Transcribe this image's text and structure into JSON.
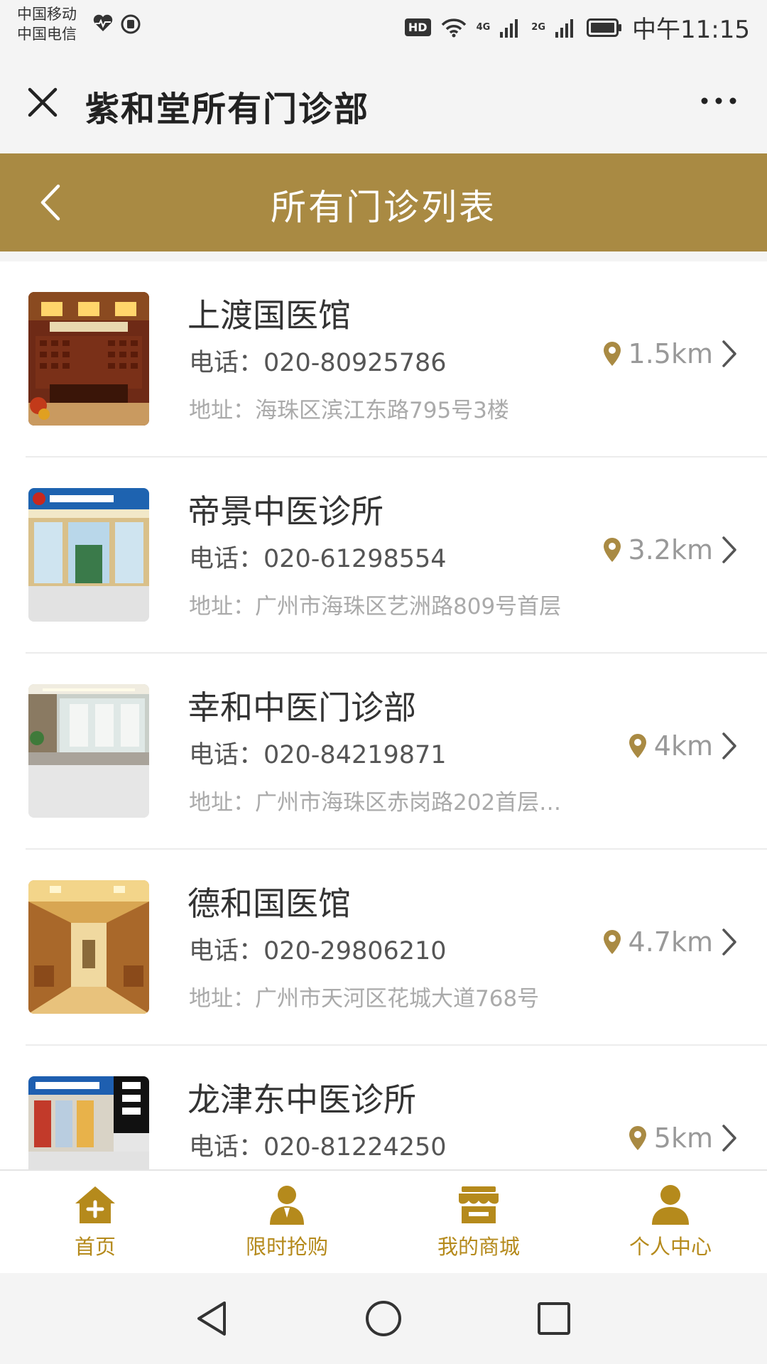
{
  "status_bar": {
    "carrier_1": "中国移动",
    "carrier_2": "中国电信",
    "hd": "HD",
    "net_1": "4G",
    "net_2": "2G",
    "time": "中午11:15",
    "icons": [
      "heart-rate-icon",
      "shield-icon",
      "wifi-icon",
      "signal-icon",
      "battery-icon"
    ]
  },
  "title_bar": {
    "title": "紫和堂所有门诊部",
    "close_icon": "close-icon",
    "more_icon": "more-icon"
  },
  "header": {
    "title": "所有门诊列表",
    "back_icon": "chevron-left-icon"
  },
  "clinics": [
    {
      "name": "上渡国医馆",
      "phone": "电话：020-80925786",
      "address": "地址：海珠区滨江东路795号3楼",
      "distance": "1.5km"
    },
    {
      "name": "帝景中医诊所",
      "phone": "电话：020-61298554",
      "address": "地址：广州市海珠区艺洲路809号首层",
      "distance": "3.2km"
    },
    {
      "name": "幸和中医门诊部",
      "phone": "电话：020-84219871",
      "address": "地址：广州市海珠区赤岗路202首层…",
      "distance": "4km"
    },
    {
      "name": "德和国医馆",
      "phone": "电话：020-29806210",
      "address": "地址：广州市天河区花城大道768号",
      "distance": "4.7km"
    },
    {
      "name": "龙津东中医诊所",
      "phone": "电话：020-81224250",
      "address": "",
      "distance": "5km"
    }
  ],
  "bottom_nav": [
    {
      "label": "首页",
      "icon": "home-icon"
    },
    {
      "label": "限时抢购",
      "icon": "user-tie-icon"
    },
    {
      "label": "我的商城",
      "icon": "shop-icon"
    },
    {
      "label": "个人中心",
      "icon": "person-icon"
    }
  ],
  "colors": {
    "header_gold": "#a98a43",
    "nav_gold": "#b58a1c"
  }
}
